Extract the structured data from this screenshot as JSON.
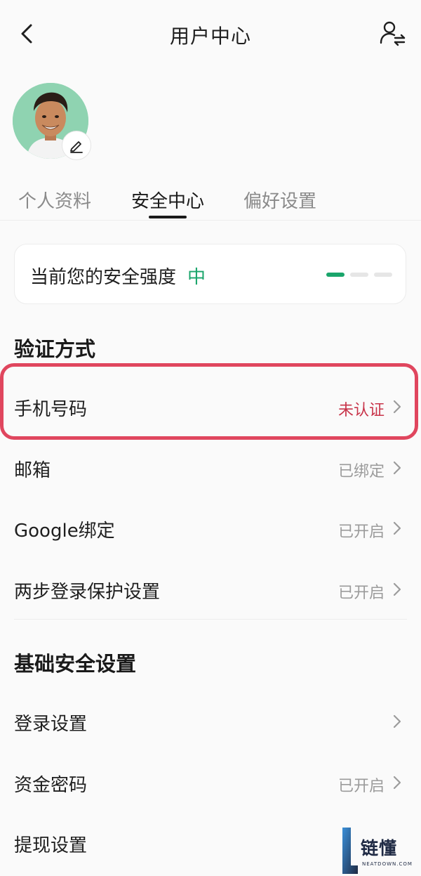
{
  "header": {
    "title": "用户中心",
    "back_icon": "chevron-left-icon",
    "switch_icon": "user-switch-icon"
  },
  "profile": {
    "avatar_icon": "avatar",
    "edit_icon": "pencil-icon"
  },
  "tabs": [
    {
      "label": "个人资料",
      "active": false
    },
    {
      "label": "安全中心",
      "active": true
    },
    {
      "label": "偏好设置",
      "active": false
    }
  ],
  "security_strength": {
    "label": "当前您的安全强度",
    "level": "中",
    "segments_filled": 1,
    "segments_total": 3,
    "colors": {
      "active": "#1aa56b",
      "inactive": "#e6e6e6"
    }
  },
  "verification": {
    "title": "验证方式",
    "items": [
      {
        "label": "手机号码",
        "status": "未认证",
        "highlighted": true
      },
      {
        "label": "邮箱",
        "status": "已绑定"
      },
      {
        "label": "Google绑定",
        "status": "已开启"
      },
      {
        "label": "两步登录保护设置",
        "status": "已开启"
      }
    ]
  },
  "basic_security": {
    "title": "基础安全设置",
    "items": [
      {
        "label": "登录设置",
        "status": ""
      },
      {
        "label": "资金密码",
        "status": "已开启"
      },
      {
        "label": "提现设置",
        "status": ""
      }
    ]
  },
  "watermark": {
    "text": "链懂",
    "sub": "NEATDOWN.COM"
  },
  "colors": {
    "accent_green": "#1aa56b",
    "warn_red": "#c8344a",
    "highlight_border": "#e0465e"
  }
}
